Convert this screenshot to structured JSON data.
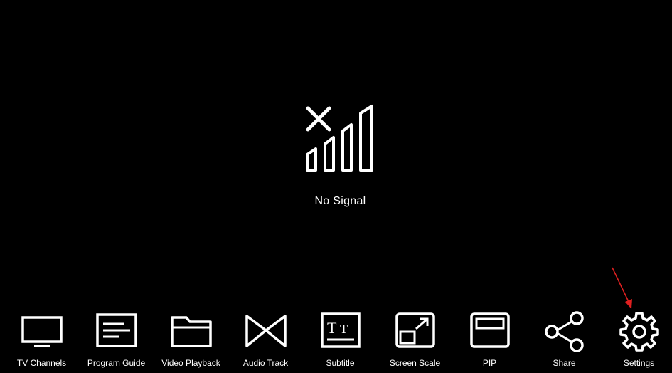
{
  "status": {
    "message": "No Signal",
    "icon": "no-signal-icon"
  },
  "menu": {
    "items": [
      {
        "label": "TV Channels",
        "icon": "tv-icon"
      },
      {
        "label": "Program Guide",
        "icon": "guide-icon"
      },
      {
        "label": "Video Playback",
        "icon": "folder-icon"
      },
      {
        "label": "Audio Track",
        "icon": "audio-track-icon"
      },
      {
        "label": "Subtitle",
        "icon": "subtitle-icon"
      },
      {
        "label": "Screen Scale",
        "icon": "screen-scale-icon"
      },
      {
        "label": "PIP",
        "icon": "pip-icon"
      },
      {
        "label": "Share",
        "icon": "share-icon"
      },
      {
        "label": "Settings",
        "icon": "gear-icon"
      }
    ]
  },
  "annotation": {
    "arrow_color": "#e02020",
    "target": "Settings"
  },
  "colors": {
    "background": "#000000",
    "foreground": "#ffffff"
  }
}
